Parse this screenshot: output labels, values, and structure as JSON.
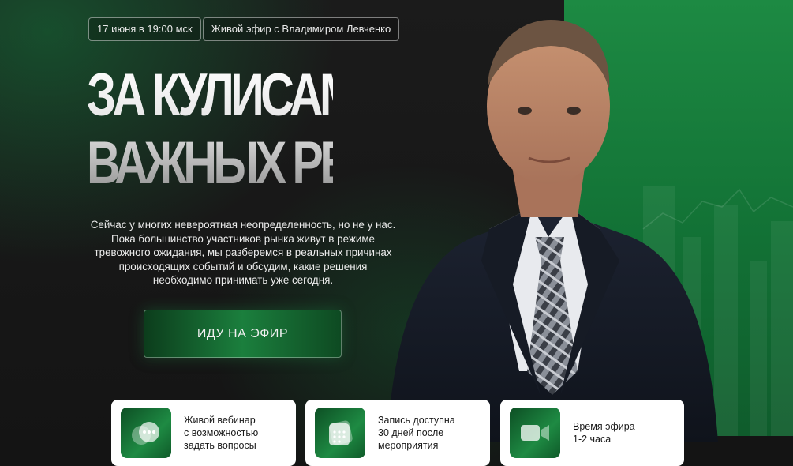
{
  "event": {
    "date": "17 июня в 19:00 мск",
    "label": "Живой эфир с Владимиром Левченко"
  },
  "headline": {
    "line1": "ЗА КУЛИСАМИ",
    "line2": "ВАЖНЫХ РЕШЕНИЙ"
  },
  "description": "Сейчас у многих невероятная неопределенность, но не у нас. Пока большинство участников рынка живут в режиме тревожного ожидания, мы разберемся в реальных причинах происходящих событий и обсудим, какие решения необходимо принимать уже сегодня.",
  "cta": {
    "label": "ИДУ НА ЭФИР"
  },
  "features": [
    {
      "icon": "chat-bubbles-icon",
      "lines": [
        "Живой вебинар",
        "с возможностью",
        "задать вопросы"
      ]
    },
    {
      "icon": "calendar-icon",
      "lines": [
        "Запись доступна",
        "30 дней после",
        "мероприятия"
      ]
    },
    {
      "icon": "video-camera-icon",
      "lines": [
        "Время эфира",
        "1-2 часа"
      ]
    }
  ],
  "colors": {
    "background": "#141414",
    "accent_green": "#1b7f3d",
    "card_bg": "#ffffff"
  }
}
